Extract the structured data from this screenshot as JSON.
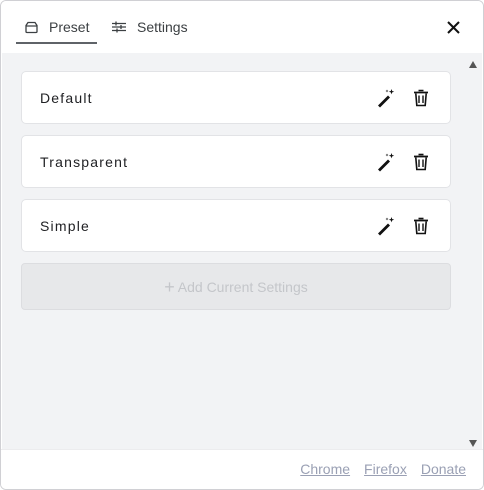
{
  "tabs": [
    {
      "label": "Preset",
      "icon": "archive-icon",
      "active": true
    },
    {
      "label": "Settings",
      "icon": "sliders-icon",
      "active": false
    }
  ],
  "close_icon": "close-icon",
  "presets": [
    {
      "name": "Default"
    },
    {
      "name": "Transparent"
    },
    {
      "name": "Simple"
    }
  ],
  "add_button": {
    "plus": "+",
    "label": "Add Current Settings"
  },
  "footer": {
    "links": [
      "Chrome",
      "Firefox",
      "Donate"
    ]
  },
  "colors": {
    "content_bg": "#f2f3f5",
    "link": "#9aa0b4",
    "disabled_text": "#c4c6ca"
  }
}
